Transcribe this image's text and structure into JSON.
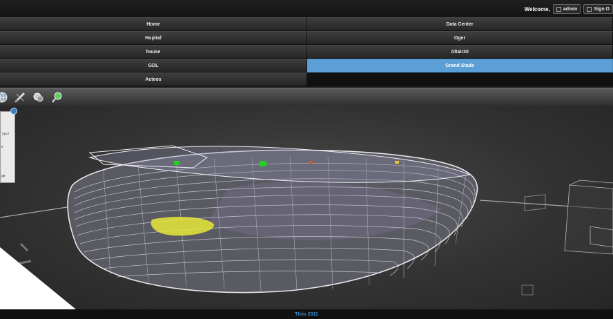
{
  "header": {
    "welcome": "Welcome,",
    "user_button": "admin",
    "signout_button": "Sign O"
  },
  "menu": {
    "left": [
      "Home",
      "Hopital",
      "house",
      "GDL",
      "Acteos"
    ],
    "right": [
      "Data Center",
      "Oger",
      "Altair30",
      "Grand Stade"
    ],
    "active": "Grand Stade"
  },
  "toolbar": {
    "icons": [
      "globe-icon",
      "measure-icon",
      "layers-icon",
      "search-icon"
    ]
  },
  "side_panel": {
    "lines": [
      "?3=?",
      "e",
      "ge"
    ]
  },
  "footer": {
    "text": "Ttnis 2011"
  },
  "colors": {
    "active_tab": "#5c9fd6",
    "footer_text": "#3d8fd1",
    "marker_green": "#1fd21f",
    "marker_yellow": "#e8e83a"
  }
}
